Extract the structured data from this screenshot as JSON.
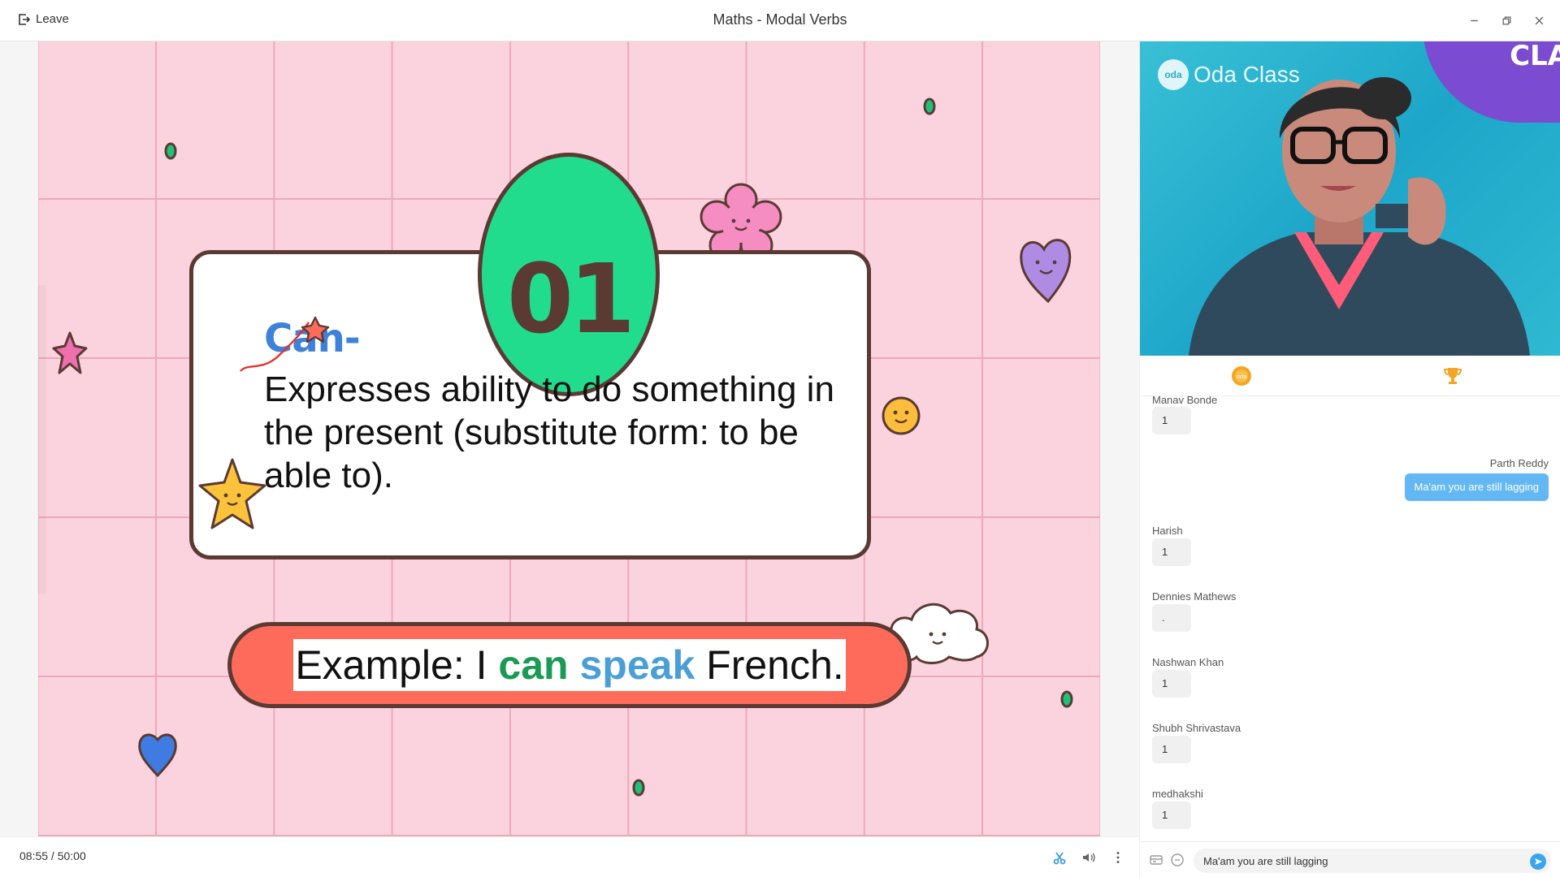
{
  "app": {
    "title": "Maths - Modal Verbs",
    "leave_label": "Leave"
  },
  "slide": {
    "number": "01",
    "logo_word": "Can-",
    "definition": "Expresses ability to do something in the present (substitute form: to be able to).",
    "example_prefix": "Example: I ",
    "example_can": "can",
    "example_speak": "speak",
    "example_suffix": " French.",
    "colors": {
      "background": "#fbd3de",
      "grid": "#eca9bc",
      "oval": "#21dc8d",
      "outline": "#5a3a33",
      "pill": "#ff6b5a",
      "can": "#1a9a55",
      "speak": "#4a9fd6"
    }
  },
  "player": {
    "current_time": "08:55",
    "separator": " / ",
    "duration": "50:00",
    "icons": [
      "scissors-icon",
      "volume-icon",
      "more-vertical-icon"
    ]
  },
  "video": {
    "brand": "Oda Class",
    "brand_badge": "oda",
    "wall_text": "CLA"
  },
  "tabs": [
    "oda-coin-icon",
    "trophy-icon"
  ],
  "chat": {
    "partial_name": "Manav Bonde",
    "messages": [
      {
        "name": "Manav Bonde",
        "text": "1",
        "own": false
      },
      {
        "name": "Parth Reddy",
        "text": "Ma'am you are still lagging",
        "own": true
      },
      {
        "name": "Harish",
        "text": "1",
        "own": false
      },
      {
        "name": "Dennies Mathews",
        "text": ".",
        "own": false
      },
      {
        "name": "Nashwan Khan",
        "text": "1",
        "own": false
      },
      {
        "name": "Shubh Shrivastava",
        "text": "1",
        "own": false
      },
      {
        "name": "medhakshi",
        "text": "1",
        "own": false
      }
    ]
  },
  "composer": {
    "value": "Ma'am you are still lagging"
  }
}
